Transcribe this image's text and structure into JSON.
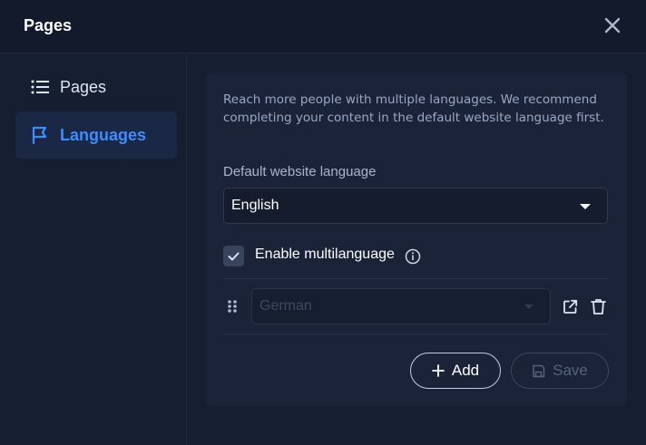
{
  "header": {
    "title": "Pages",
    "close_icon": "close-icon"
  },
  "sidebar": {
    "items": [
      {
        "label": "Pages",
        "icon": "list-icon",
        "active": false
      },
      {
        "label": "Languages",
        "icon": "flag-icon",
        "active": true
      }
    ]
  },
  "languages": {
    "intro": "Reach more people with multiple languages. We recommend completing your content in the default website language first.",
    "default_label": "Default website language",
    "default_value": "English",
    "multilanguage_label": "Enable multilanguage",
    "multilanguage_checked": true,
    "rows": [
      {
        "language": "German",
        "disabled": true
      }
    ],
    "add_label": "Add",
    "save_label": "Save"
  },
  "colors": {
    "background": "#161e31",
    "accent": "#3a8dff",
    "active_nav_bg": "#1b2845"
  }
}
